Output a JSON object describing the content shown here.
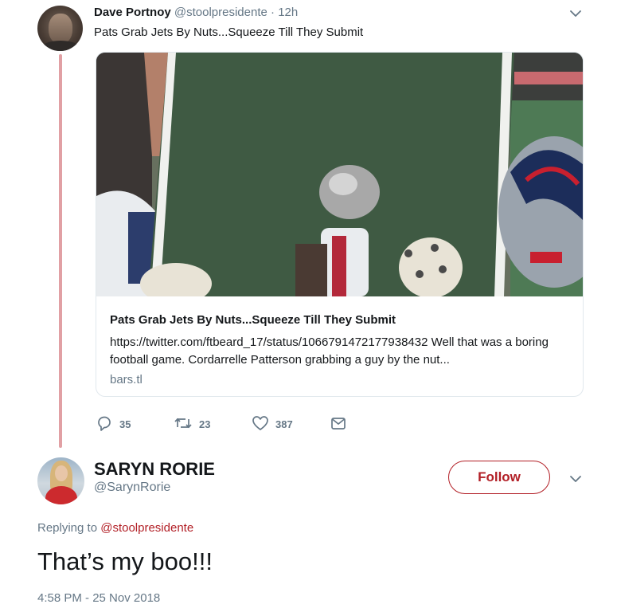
{
  "tweet": {
    "author_name": "Dave Portnoy",
    "author_handle": "@stoolpresidente",
    "separator": "·",
    "time_ago": "12h",
    "text": "Pats Grab Jets By Nuts...Squeeze Till They Submit",
    "card": {
      "title": "Pats Grab Jets By Nuts...Squeeze Till They Submit",
      "description": "https://twitter.com/ftbeard_17/status/1066791472177938432 Well that was a boring football game. Cordarrelle Patterson grabbing a guy by the nut...",
      "domain": "bars.tl"
    },
    "actions": {
      "reply_count": "35",
      "retweet_count": "23",
      "like_count": "387"
    },
    "icons": [
      "reply-icon",
      "retweet-icon",
      "like-icon",
      "dm-icon",
      "chevron-down-icon"
    ]
  },
  "reply": {
    "author_name": "SARYN RORIE",
    "author_handle": "@SarynRorie",
    "follow_label": "Follow",
    "replying_prefix": "Replying to",
    "replying_handle": "@stoolpresidente",
    "text": "That’s my boo!!!",
    "timestamp": "4:58 PM - 25 Nov 2018"
  },
  "colors": {
    "accent": "#b21f26",
    "thread_line": "#e1a0a4",
    "muted_text": "#657786",
    "text": "#14171a",
    "border": "#e1e8ed"
  }
}
